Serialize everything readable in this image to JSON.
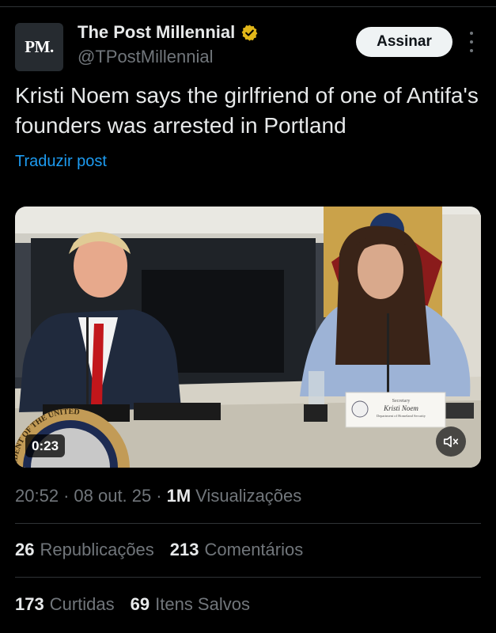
{
  "author": {
    "avatar_text": "PM.",
    "display_name": "The Post Millennial",
    "handle": "@TPostMillennial",
    "verified_badge_color": "#e2b719"
  },
  "follow_label": "Assinar",
  "more_icon": "more-vertical-icon",
  "post": {
    "text": "Kristi Noem says the girlfriend of one of Antifa's founders was arrested in Portland",
    "translate_label": "Traduzir post"
  },
  "media": {
    "type": "video",
    "duration": "0:23",
    "nameplate_title": "Secretary",
    "nameplate_name": "Kristi Noem",
    "nameplate_dept": "Department of Homeland Security",
    "seal_text": "SIDENT OF THE UNITED",
    "mute_icon": "volume-muted-icon"
  },
  "meta": {
    "time": "20:52",
    "sep1": "·",
    "date": "08 out. 25",
    "sep2": "·",
    "views": "1M",
    "views_label": "Visualizações"
  },
  "stats": {
    "reposts": "26",
    "reposts_label": "Republicações",
    "comments": "213",
    "comments_label": "Comentários",
    "likes": "173",
    "likes_label": "Curtidas",
    "saves": "69",
    "saves_label": "Itens Salvos"
  },
  "colors": {
    "background": "#000000",
    "link": "#1d9bf0",
    "secondary_text": "#71767b"
  }
}
